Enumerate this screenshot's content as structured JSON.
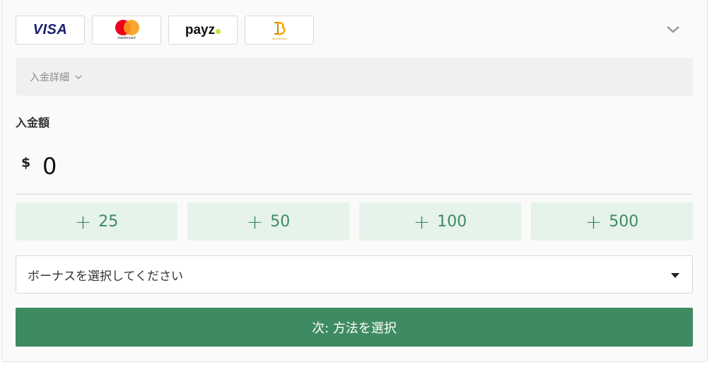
{
  "payment_methods": [
    {
      "id": "visa",
      "label": "VISA"
    },
    {
      "id": "mastercard",
      "label": "mastercard"
    },
    {
      "id": "payz",
      "label": "payz"
    },
    {
      "id": "muchbetter",
      "label": "MuchBetter"
    }
  ],
  "details": {
    "label": "入金詳細"
  },
  "amount": {
    "label": "入金額",
    "currency": "$",
    "value": "0"
  },
  "quick_amounts": [
    "25",
    "50",
    "100",
    "500"
  ],
  "bonus": {
    "placeholder": "ボーナスを選択してください"
  },
  "next_button": {
    "label": "次: 方法を選択"
  },
  "colors": {
    "accent": "#3f8b61",
    "quick_bg": "#e6f3ea",
    "quick_text": "#3e8b62"
  }
}
